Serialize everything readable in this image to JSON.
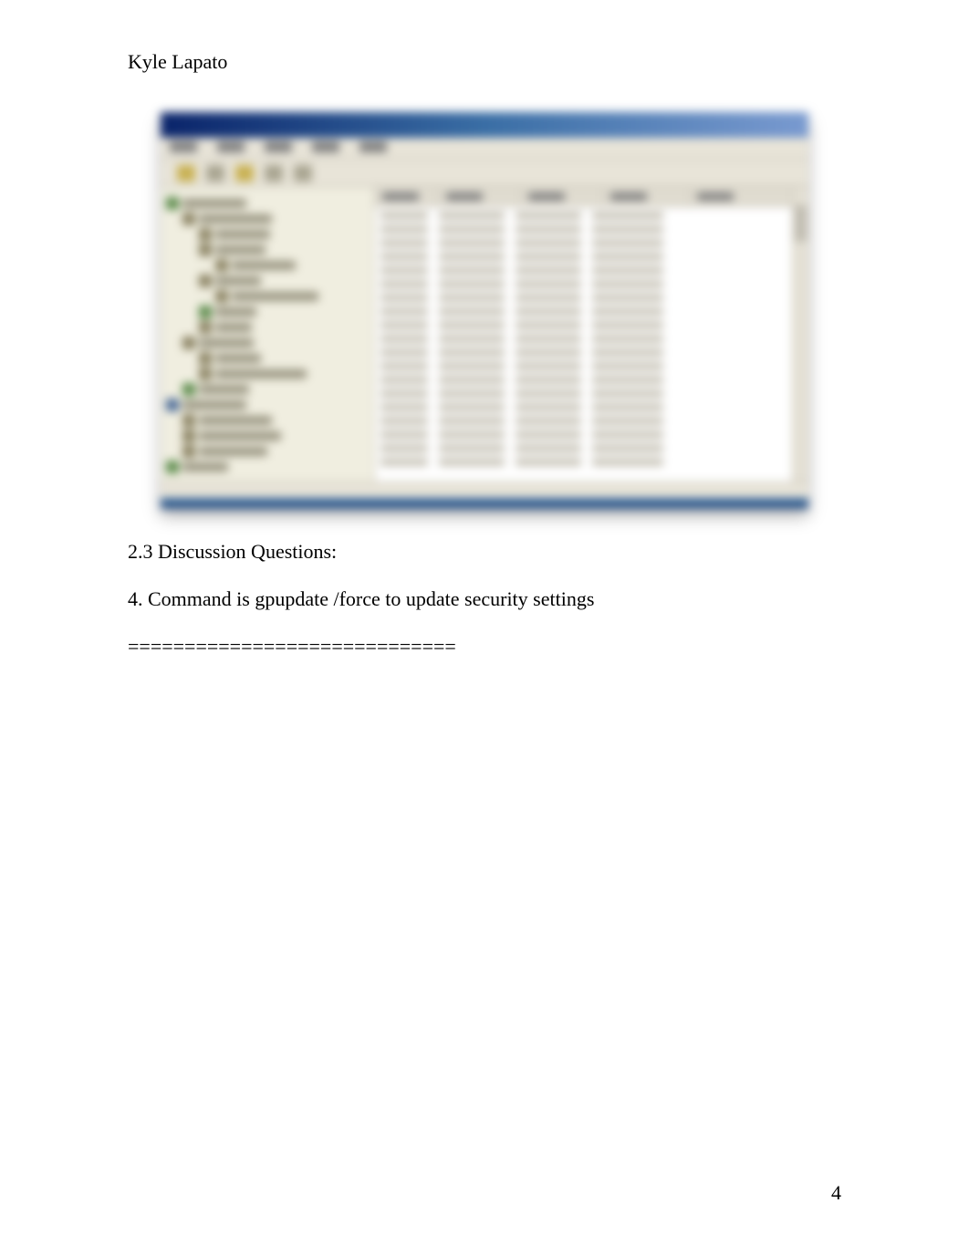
{
  "author": "Kyle Lapato",
  "screenshot": {
    "description": "blurred Windows application window with tree view and list view"
  },
  "content": {
    "heading": "2.3 Discussion Questions:",
    "answer": "4. Command is gpupdate /force to update security settings",
    "divider": "============================="
  },
  "page_number": "4"
}
